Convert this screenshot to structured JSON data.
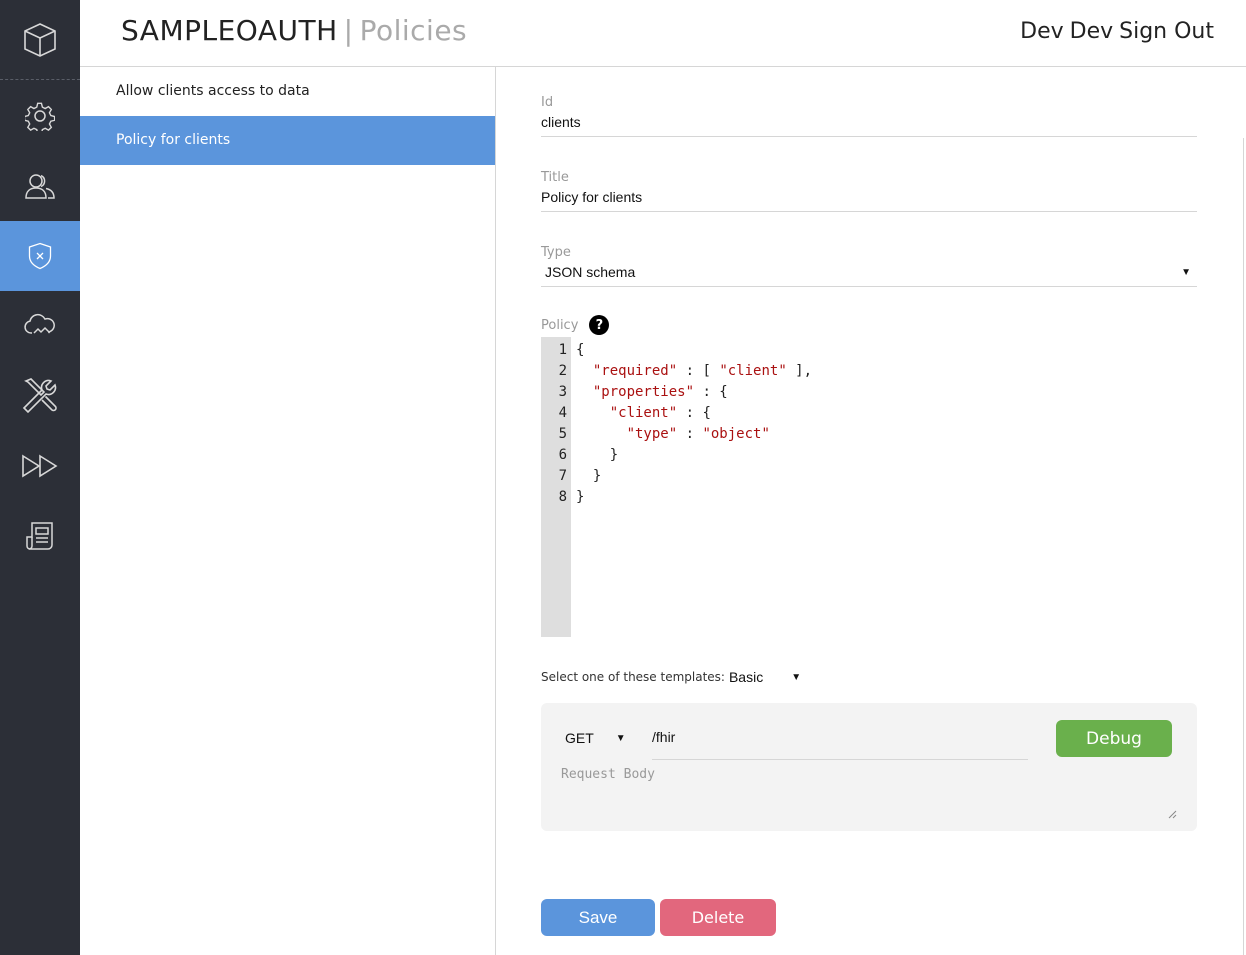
{
  "header": {
    "brand": "SAMPLEOAUTH",
    "separator": "|",
    "section": "Policies",
    "user_first": "Dev",
    "user_last": "Dev",
    "signout": "Sign Out"
  },
  "sidebar": {
    "items": [
      {
        "icon": "cube-icon",
        "active": false
      },
      {
        "icon": "gear-icon",
        "active": false
      },
      {
        "icon": "users-icon",
        "active": false
      },
      {
        "icon": "shield-icon",
        "active": true
      },
      {
        "icon": "cloud-icon",
        "active": false
      },
      {
        "icon": "tools-icon",
        "active": false
      },
      {
        "icon": "fast-forward-icon",
        "active": false
      },
      {
        "icon": "document-icon",
        "active": false
      }
    ],
    "active_color": "#5b95dc",
    "background": "#2c2f37"
  },
  "policies": {
    "items": [
      {
        "label": "Allow clients access to data",
        "selected": false
      },
      {
        "label": "Policy for clients",
        "selected": true
      }
    ]
  },
  "form": {
    "id_label": "Id",
    "id_value": "clients",
    "title_label": "Title",
    "title_value": "Policy for clients",
    "type_label": "Type",
    "type_value": "JSON schema",
    "policy_label": "Policy",
    "help": "?",
    "code_lines": [
      {
        "n": "1",
        "text": "{"
      },
      {
        "n": "2",
        "text": "  \"required\" : [ \"client\" ],"
      },
      {
        "n": "3",
        "text": "  \"properties\" : {"
      },
      {
        "n": "4",
        "text": "    \"client\" : {"
      },
      {
        "n": "5",
        "text": "      \"type\" : \"object\""
      },
      {
        "n": "6",
        "text": "    }"
      },
      {
        "n": "7",
        "text": "  }"
      },
      {
        "n": "8",
        "text": "}"
      }
    ],
    "templates_label": "Select one of these templates:",
    "template_value": "Basic"
  },
  "debug": {
    "method": "GET",
    "url": "/fhir",
    "request_body_placeholder": "Request Body",
    "debug_label": "Debug"
  },
  "actions": {
    "save_label": "Save",
    "delete_label": "Delete"
  }
}
